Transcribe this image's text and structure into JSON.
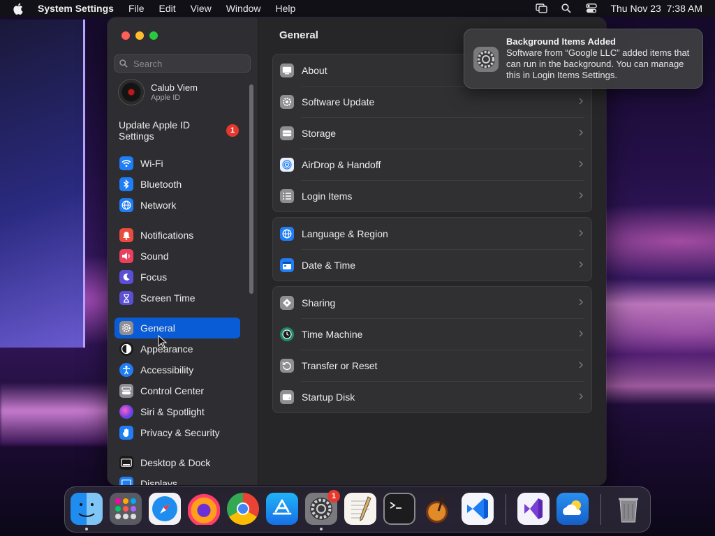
{
  "menubar": {
    "app_name": "System Settings",
    "menus": [
      "File",
      "Edit",
      "View",
      "Window",
      "Help"
    ],
    "datetime": "Thu Nov 23  7:38 AM"
  },
  "sidebar": {
    "search_placeholder": "Search",
    "account": {
      "name": "Calub Viem",
      "subtitle": "Apple ID"
    },
    "update": {
      "label": "Update Apple ID Settings",
      "badge": "1"
    },
    "items": [
      {
        "label": "Wi-Fi",
        "icon": "wifi-icon",
        "color": "#1f7ef5"
      },
      {
        "label": "Bluetooth",
        "icon": "bluetooth-icon",
        "color": "#1f7ef5"
      },
      {
        "label": "Network",
        "icon": "globe-icon",
        "color": "#1f7ef5"
      },
      {
        "label": "Notifications",
        "icon": "bell-icon",
        "color": "#eb4b3f"
      },
      {
        "label": "Sound",
        "icon": "speaker-icon",
        "color": "#eb3f5e"
      },
      {
        "label": "Focus",
        "icon": "moon-icon",
        "color": "#5b4fd6"
      },
      {
        "label": "Screen Time",
        "icon": "hourglass-icon",
        "color": "#5b4fd6"
      },
      {
        "label": "General",
        "icon": "gear-icon",
        "color": "#8e8e93",
        "selected": true
      },
      {
        "label": "Appearance",
        "icon": "appearance-icon",
        "color": "#1a1a1a"
      },
      {
        "label": "Accessibility",
        "icon": "accessibility-icon",
        "color": "#1f7ef5"
      },
      {
        "label": "Control Center",
        "icon": "control-center-icon",
        "color": "#8e8e93"
      },
      {
        "label": "Siri & Spotlight",
        "icon": "siri-icon",
        "color": "#b03fd6"
      },
      {
        "label": "Privacy & Security",
        "icon": "hand-icon",
        "color": "#1f7ef5"
      },
      {
        "label": "Desktop & Dock",
        "icon": "dock-icon",
        "color": "#1a1a1a"
      },
      {
        "label": "Displays",
        "icon": "display-icon",
        "color": "#1f7ef5"
      }
    ]
  },
  "main": {
    "title": "General",
    "groups": [
      [
        {
          "label": "About",
          "icon": "about-icon"
        },
        {
          "label": "Software Update",
          "icon": "gear-badge-icon"
        },
        {
          "label": "Storage",
          "icon": "storage-icon"
        },
        {
          "label": "AirDrop & Handoff",
          "icon": "airdrop-icon"
        },
        {
          "label": "Login Items",
          "icon": "list-icon"
        }
      ],
      [
        {
          "label": "Language & Region",
          "icon": "globe-icon"
        },
        {
          "label": "Date & Time",
          "icon": "calendar-icon"
        }
      ],
      [
        {
          "label": "Sharing",
          "icon": "sharing-icon"
        },
        {
          "label": "Time Machine",
          "icon": "time-machine-icon"
        },
        {
          "label": "Transfer or Reset",
          "icon": "reset-icon"
        },
        {
          "label": "Startup Disk",
          "icon": "disk-icon"
        }
      ]
    ]
  },
  "notification": {
    "title": "Background Items Added",
    "body": "Software from “Google LLC” added items that can run in the background. You can manage this in Login Items Settings."
  },
  "dock": {
    "settings_badge": "1",
    "apps": [
      "Finder",
      "Launchpad",
      "Safari",
      "Firefox",
      "Chrome",
      "App Store",
      "System Settings",
      "TextEdit",
      "Terminal",
      "GarageBand",
      "Visual Studio Code",
      "Visual Studio",
      "Weather",
      "Trash"
    ]
  }
}
